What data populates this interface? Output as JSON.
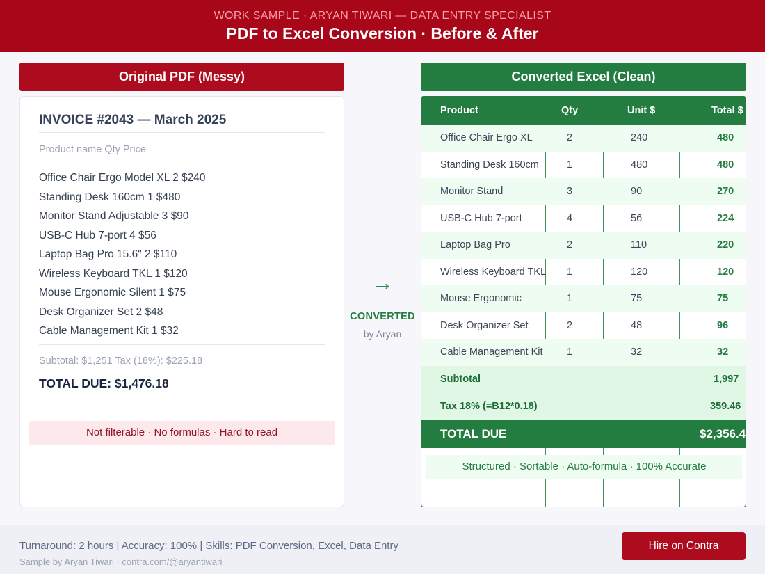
{
  "header": {
    "kicker": "WORK SAMPLE · ARYAN TIWARI — DATA ENTRY SPECIALIST",
    "title": "PDF to Excel Conversion · Before & After"
  },
  "pdf": {
    "heading": "Original PDF (Messy)",
    "invoice_title": "INVOICE #2043 — March 2025",
    "columns_text": "Product name Qty Price",
    "lines": [
      "Office Chair Ergo Model XL 2 $240",
      "Standing Desk 160cm 1 $480",
      "Monitor Stand Adjustable 3 $90",
      "USB-C Hub 7-port 4 $56",
      "Laptop Bag Pro 15.6\" 2 $110",
      "Wireless Keyboard TKL 1 $120",
      "Mouse Ergonomic Silent 1 $75",
      "Desk Organizer Set 2 $48",
      "Cable Management Kit 1 $32"
    ],
    "subtotal_text": "Subtotal: $1,251 Tax (18%): $225.18",
    "total_text": "TOTAL DUE: $1,476.18",
    "warning": "Not filterable · No formulas · Hard to read"
  },
  "middle": {
    "arrow": "→",
    "label": "CONVERTED",
    "by": "by Aryan"
  },
  "excel": {
    "heading": "Converted Excel (Clean)",
    "columns": [
      "Product",
      "Qty",
      "Unit $",
      "Total $"
    ],
    "rows": [
      {
        "product": "Office Chair Ergo XL",
        "qty": "2",
        "unit": "240",
        "total": "480"
      },
      {
        "product": "Standing Desk 160cm",
        "qty": "1",
        "unit": "480",
        "total": "480"
      },
      {
        "product": "Monitor Stand",
        "qty": "3",
        "unit": "90",
        "total": "270"
      },
      {
        "product": "USB-C Hub 7-port",
        "qty": "4",
        "unit": "56",
        "total": "224"
      },
      {
        "product": "Laptop Bag Pro",
        "qty": "2",
        "unit": "110",
        "total": "220"
      },
      {
        "product": "Wireless Keyboard TKL",
        "qty": "1",
        "unit": "120",
        "total": "120"
      },
      {
        "product": "Mouse Ergonomic",
        "qty": "1",
        "unit": "75",
        "total": "75"
      },
      {
        "product": "Desk Organizer Set",
        "qty": "2",
        "unit": "48",
        "total": "96"
      },
      {
        "product": "Cable Management Kit",
        "qty": "1",
        "unit": "32",
        "total": "32"
      }
    ],
    "subtotal_label": "Subtotal",
    "subtotal_value": "1,997",
    "tax_label": "Tax 18% (=B12*0.18)",
    "tax_value": "359.46",
    "total_label": "TOTAL DUE",
    "total_value": "$2,356.4",
    "note": "Structured · Sortable · Auto-formula · 100% Accurate"
  },
  "footer": {
    "stats": "Turnaround: 2 hours | Accuracy: 100% | Skills: PDF Conversion, Excel, Data Entry",
    "credit": "Sample by Aryan Tiwari · contra.com/@aryantiwari",
    "hire_label": "Hire on Contra"
  },
  "colors": {
    "brand_red": "#a8071a",
    "excel_green": "#237c40",
    "alt_row_green": "#effcf2",
    "warning_bg": "#fde8ec"
  }
}
